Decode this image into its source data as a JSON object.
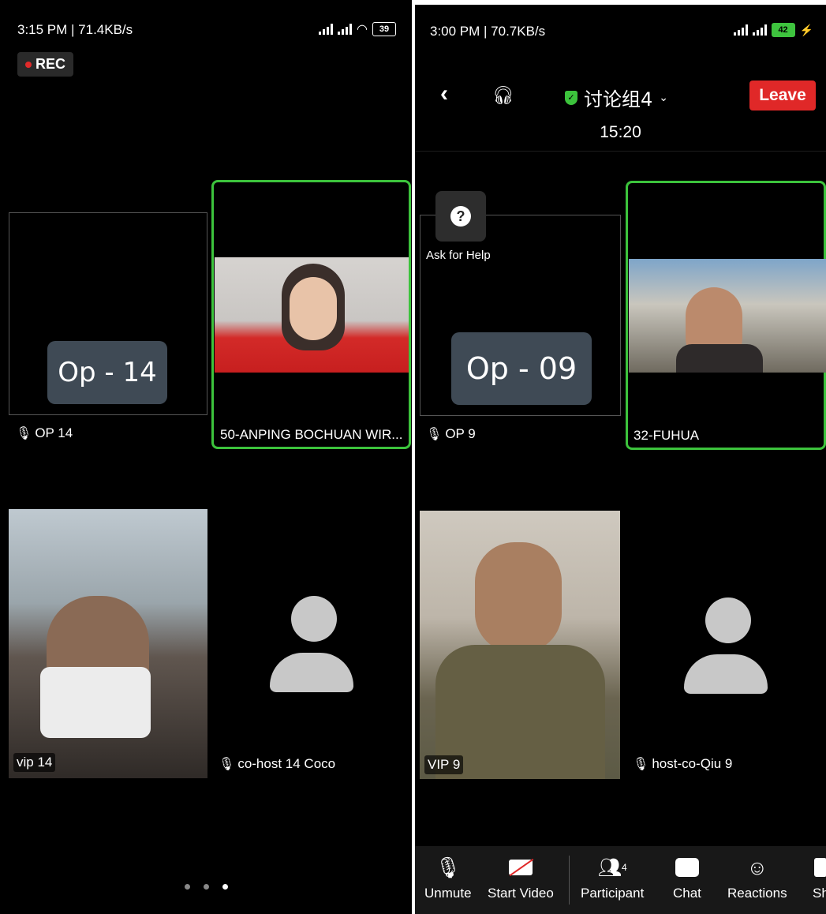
{
  "left": {
    "status": {
      "time": "3:15 PM | 71.4KB/s",
      "battery": "39"
    },
    "rec_label": "REC",
    "tiles": [
      {
        "name": "OP 14",
        "tag": "Op - 14"
      },
      {
        "name": "50-ANPING BOCHUAN WIR..."
      },
      {
        "name": "vip 14"
      },
      {
        "name": "co-host 14  Coco"
      }
    ]
  },
  "right": {
    "status": {
      "time": "3:00 PM | 70.7KB/s",
      "battery": "42"
    },
    "meeting": {
      "title": "讨论组4",
      "timer": "15:20",
      "leave_label": "Leave"
    },
    "ask_help": {
      "icon_text": "?",
      "label": "Ask for Help"
    },
    "tiles": [
      {
        "name": "OP 9",
        "tag": "Op - 09"
      },
      {
        "name": "32-FUHUA"
      },
      {
        "name": "VIP 9"
      },
      {
        "name": "host-co-Qiu 9"
      }
    ],
    "toolbar": {
      "unmute": "Unmute",
      "start_video": "Start Video",
      "participant": "Participant",
      "participant_count": "4",
      "chat": "Chat",
      "reactions": "Reactions",
      "share_partial": "Sh"
    }
  },
  "colors": {
    "active_border": "#3cc33c",
    "leave": "#e02828",
    "shield": "#3cc33c"
  }
}
